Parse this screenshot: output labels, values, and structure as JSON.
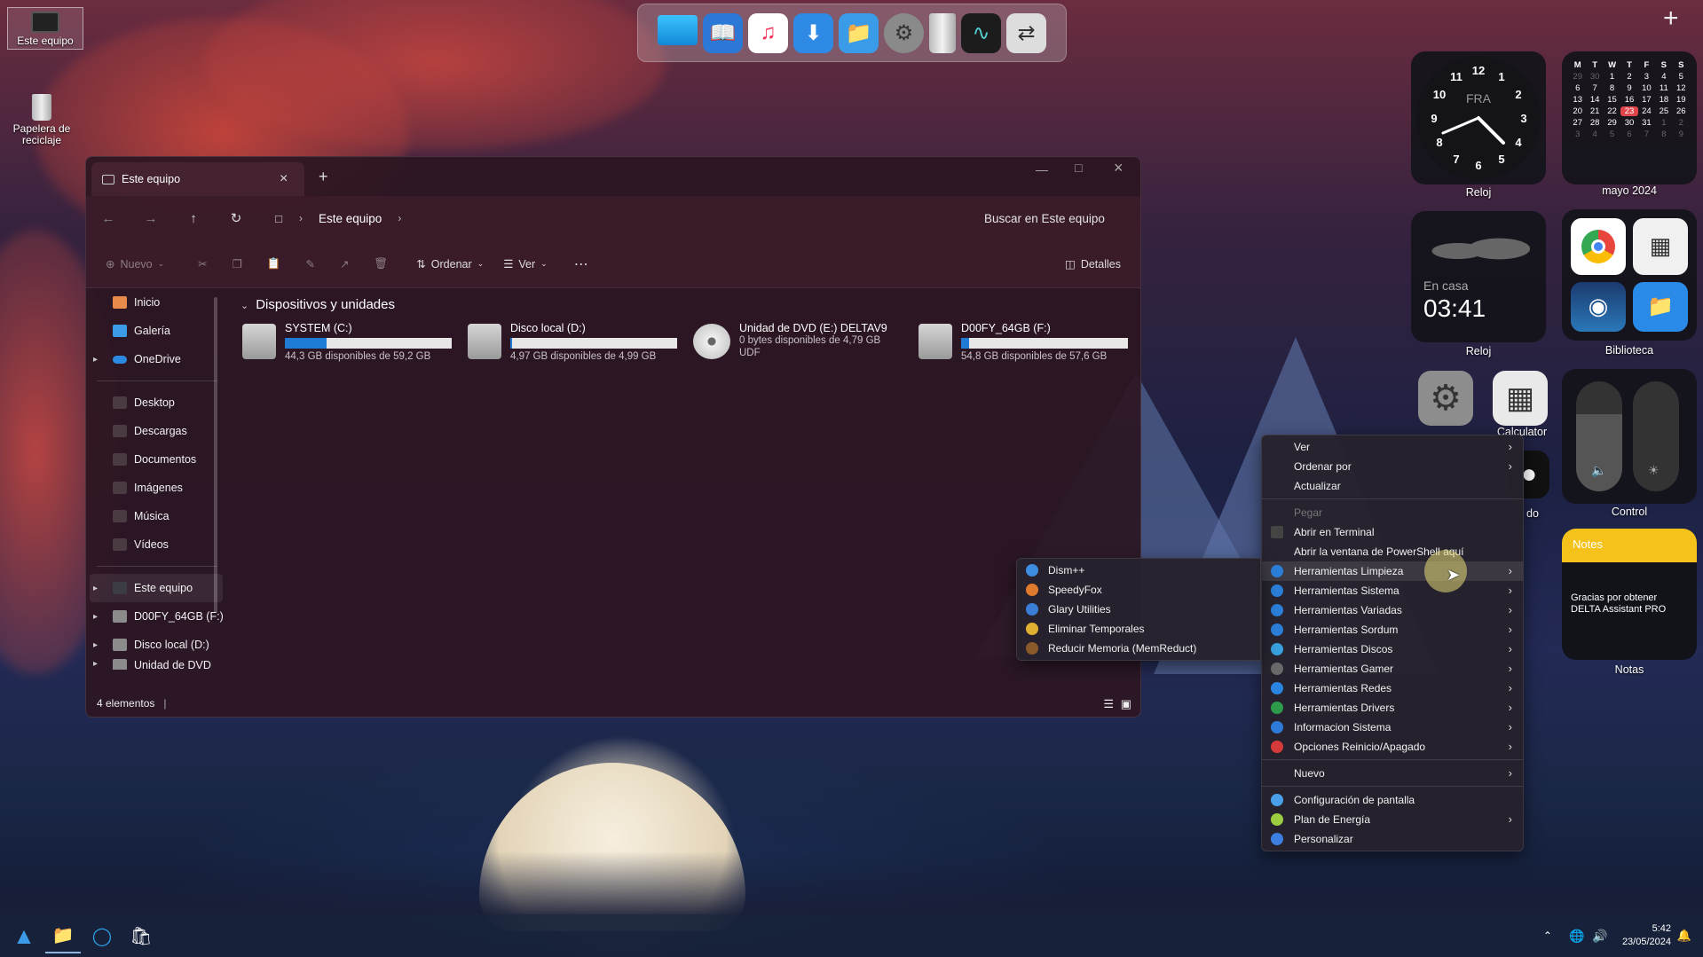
{
  "desktop_icons": [
    {
      "label": "Este equipo"
    },
    {
      "label": "Papelera de reciclaje"
    }
  ],
  "dock": {
    "items": [
      "monitor-icon",
      "books-icon",
      "music-icon",
      "download-icon",
      "folder-icon",
      "settings-icon",
      "trash-icon",
      "activity-icon",
      "toggle-icon"
    ]
  },
  "explorer": {
    "tab_title": "Este equipo",
    "breadcrumb": "Este equipo",
    "search_placeholder": "Buscar en Este equipo",
    "toolbar": {
      "new": "Nuevo",
      "sort": "Ordenar",
      "view": "Ver",
      "details": "Detalles"
    },
    "sidebar": {
      "top": [
        {
          "label": "Inicio"
        },
        {
          "label": "Galería"
        },
        {
          "label": "OneDrive"
        }
      ],
      "folders": [
        {
          "label": "Desktop"
        },
        {
          "label": "Descargas"
        },
        {
          "label": "Documentos"
        },
        {
          "label": "Imágenes"
        },
        {
          "label": "Música"
        },
        {
          "label": "Vídeos"
        }
      ],
      "drives": [
        {
          "label": "Este equipo"
        },
        {
          "label": "D00FY_64GB (F:)"
        },
        {
          "label": "Disco local (D:)"
        },
        {
          "label": "Unidad de DVD"
        }
      ]
    },
    "section_title": "Dispositivos y unidades",
    "drives": [
      {
        "name": "SYSTEM (C:)",
        "info": "44,3 GB disponibles de 59,2 GB",
        "used_fraction": 0.25
      },
      {
        "name": "Disco local (D:)",
        "info": "4,97 GB disponibles de 4,99 GB",
        "used_fraction": 0.01
      },
      {
        "name": "Unidad de DVD (E:) DELTAV9",
        "info": "0 bytes disponibles de 4,79 GB",
        "info2": "UDF"
      },
      {
        "name": "D00FY_64GB (F:)",
        "info": "54,8 GB disponibles de 57,6 GB",
        "used_fraction": 0.05
      }
    ],
    "status": "4 elementos"
  },
  "widgets": {
    "clock": {
      "label": "Reloj",
      "city": "FRA",
      "numbers": [
        "12",
        "1",
        "2",
        "3",
        "4",
        "5",
        "6",
        "7",
        "8",
        "9",
        "10",
        "11"
      ]
    },
    "calendar": {
      "label": "mayo 2024",
      "days": [
        "M",
        "T",
        "W",
        "T",
        "F",
        "S",
        "S"
      ],
      "rows": [
        [
          "29",
          "30",
          "1",
          "2",
          "3",
          "4",
          "5"
        ],
        [
          "6",
          "7",
          "8",
          "9",
          "10",
          "11",
          "12"
        ],
        [
          "13",
          "14",
          "15",
          "16",
          "17",
          "18",
          "19"
        ],
        [
          "20",
          "21",
          "22",
          "23",
          "24",
          "25",
          "26"
        ],
        [
          "27",
          "28",
          "29",
          "30",
          "31",
          "1",
          "2"
        ],
        [
          "3",
          "4",
          "5",
          "6",
          "7",
          "8",
          "9"
        ]
      ],
      "today": "23"
    },
    "world": {
      "place": "En casa",
      "time": "03:41",
      "label": "Reloj"
    },
    "library": {
      "label": "Biblioteca"
    },
    "control": {
      "label": "Control"
    },
    "apps_labels": [
      "Configuración",
      "Calculator",
      "do"
    ],
    "notes": {
      "header": "Notes",
      "text": "Gracias por obtener DELTA Assistant PRO",
      "label": "Notas"
    }
  },
  "context_menu": {
    "items": [
      {
        "label": "Ver",
        "arrow": true
      },
      {
        "label": "Ordenar por",
        "arrow": true
      },
      {
        "label": "Actualizar"
      },
      {
        "sep": true
      },
      {
        "label": "Pegar",
        "disabled": true
      },
      {
        "label": "Abrir en Terminal",
        "icon": "terminal-icon"
      },
      {
        "label": "Abrir la ventana de PowerShell aquí"
      },
      {
        "label": "Herramientas Limpieza",
        "icon": "tools-icon",
        "arrow": true,
        "color": "#2b7fd9"
      },
      {
        "label": "Herramientas Sistema",
        "icon": "tools-icon",
        "arrow": true,
        "color": "#2b7fd9"
      },
      {
        "label": "Herramientas Variadas",
        "icon": "tools-icon",
        "arrow": true,
        "color": "#2b7fd9"
      },
      {
        "label": "Herramientas Sordum",
        "icon": "tools-icon",
        "arrow": true,
        "color": "#2b7fd9"
      },
      {
        "label": "Herramientas Discos",
        "icon": "disk-icon",
        "arrow": true,
        "color": "#39a0e0"
      },
      {
        "label": "Herramientas Gamer",
        "icon": "gamepad-icon",
        "arrow": true,
        "color": "#6a6a6a"
      },
      {
        "label": "Herramientas Redes",
        "icon": "network-icon",
        "arrow": true,
        "color": "#2a86e0"
      },
      {
        "label": "Herramientas Drivers",
        "icon": "drivers-icon",
        "arrow": true,
        "color": "#2e9b4b"
      },
      {
        "label": "Informacion Sistema",
        "icon": "info-icon",
        "arrow": true,
        "color": "#2d7ad8"
      },
      {
        "label": "Opciones Reinicio/Apagado",
        "icon": "power-icon",
        "arrow": true,
        "color": "#d63a3a"
      },
      {
        "sep": true
      },
      {
        "label": "Nuevo",
        "arrow": true
      },
      {
        "sep": true
      },
      {
        "label": "Configuración de pantalla",
        "icon": "display-icon",
        "color": "#4aa0e8"
      },
      {
        "label": "Plan de Energía",
        "icon": "energy-icon",
        "arrow": true,
        "color": "#9ccc40"
      },
      {
        "label": "Personalizar",
        "icon": "personalize-icon",
        "color": "#3c7fe0"
      }
    ],
    "submenu": [
      {
        "label": "Dism++",
        "color": "#3d8ee0"
      },
      {
        "label": "SpeedyFox",
        "color": "#e07a2c"
      },
      {
        "label": "Glary Utilities",
        "color": "#3a7ed8"
      },
      {
        "label": "Eliminar Temporales",
        "color": "#e0b030"
      },
      {
        "label": "Reducir Memoria (MemReduct)",
        "color": "#8a5a2a"
      }
    ]
  },
  "taskbar": {
    "time": "5:42",
    "date": "23/05/2024"
  },
  "colors": {
    "accent": "#1f7bd4",
    "notes_yellow": "#f4c21a",
    "today_red": "#e0454b"
  }
}
